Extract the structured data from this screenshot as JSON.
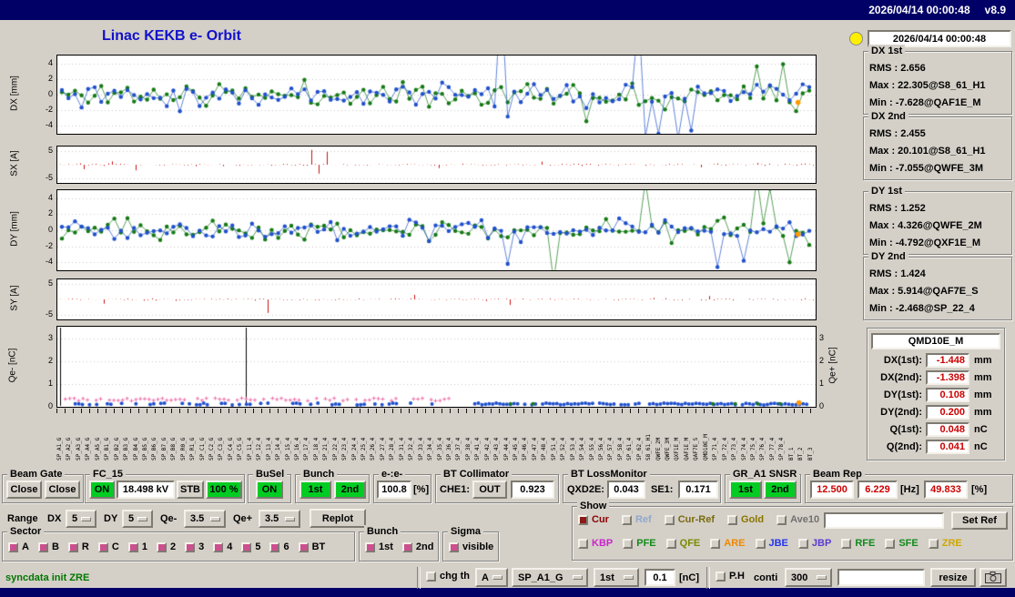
{
  "titlebar": {
    "clock": "2026/04/14 00:00:48",
    "version": "v8.9"
  },
  "header": {
    "title": "Linac KEKB e- Orbit",
    "timestamp": "2026/04/14 00:00:48"
  },
  "stats": [
    {
      "title": "DX 1st",
      "lines": [
        "RMS : 2.656",
        "Max : 22.305@S8_61_H1",
        "Min : -7.628@QAF1E_M"
      ]
    },
    {
      "title": "DX 2nd",
      "lines": [
        "RMS : 2.455",
        "Max : 20.101@S8_61_H1",
        "Min : -7.055@QWFE_3M"
      ]
    },
    {
      "title": "DY 1st",
      "lines": [
        "RMS : 1.252",
        "Max : 4.326@QWFE_2M",
        "Min : -4.792@QXF1E_M"
      ]
    },
    {
      "title": "DY 2nd",
      "lines": [
        "RMS : 1.424",
        "Max : 5.914@QAF7E_S",
        "Min : -2.468@SP_22_4"
      ]
    }
  ],
  "qmd": {
    "title": "QMD10E_M",
    "rows": [
      {
        "label": "DX(1st):",
        "value": "-1.448",
        "unit": "mm"
      },
      {
        "label": "DX(2nd):",
        "value": "-1.398",
        "unit": "mm"
      },
      {
        "label": "DY(1st):",
        "value": "0.108",
        "unit": "mm"
      },
      {
        "label": "DY(2nd):",
        "value": "0.200",
        "unit": "mm"
      },
      {
        "label": "Q(1st):",
        "value": "0.048",
        "unit": "nC"
      },
      {
        "label": "Q(2nd):",
        "value": "0.041",
        "unit": "nC"
      }
    ]
  },
  "controls": {
    "beam_gate": {
      "title": "Beam Gate",
      "close1": "Close",
      "close2": "Close"
    },
    "fc15": {
      "title": "FC_15",
      "on": "ON",
      "kv": "18.498 kV",
      "stb": "STB",
      "pct": "100 %"
    },
    "busel": {
      "title": "BuSel",
      "on": "ON"
    },
    "bunch": {
      "title": "Bunch",
      "b1": "1st",
      "b2": "2nd"
    },
    "ee": {
      "title": "e-:e-",
      "value": "100.8",
      "unit": "[%]"
    },
    "bt_col": {
      "title": "BT Collimator",
      "label": "CHE1:",
      "btn": "OUT",
      "value": "0.923"
    },
    "bt_loss": {
      "title": "BT LossMonitor",
      "l1": "QXD2E:",
      "v1": "0.043",
      "l2": "SE1:",
      "v2": "0.171"
    },
    "gr_snsr": {
      "title": "GR_A1 SNSR",
      "b1": "1st",
      "b2": "2nd"
    },
    "beam_rep": {
      "title": "Beam Rep",
      "v1": "12.500",
      "v2": "6.229",
      "u1": "[Hz]",
      "v3": "49.833",
      "u2": "[%]"
    },
    "range": {
      "label": "Range",
      "dx": "DX",
      "dx_val": "5",
      "dy": "DY",
      "dy_val": "5",
      "qem": "Qe-",
      "qem_val": "3.5",
      "qep": "Qe+",
      "qep_val": "3.5",
      "replot": "Replot"
    },
    "show": {
      "title": "Show",
      "set_ref": "Set Ref",
      "input_value": "",
      "row1": [
        {
          "label": "Cur",
          "color": "#8b0000",
          "box": "#8b1a1a"
        },
        {
          "label": "Ref",
          "color": "#8fa8cc",
          "box": "#d4d0c8"
        },
        {
          "label": "Cur-Ref",
          "color": "#7a6a10",
          "box": "#d4d0c8"
        },
        {
          "label": "Gold",
          "color": "#8a7400",
          "box": "#d4d0c8"
        },
        {
          "label": "Ave10",
          "color": "#707070",
          "box": "#d4d0c8"
        }
      ],
      "row2": [
        {
          "label": "KBP",
          "color": "#cc22cc",
          "box": "#d4d0c8"
        },
        {
          "label": "PFE",
          "color": "#118a1a",
          "box": "#d4d0c8"
        },
        {
          "label": "QFE",
          "color": "#7a8a00",
          "box": "#d4d0c8"
        },
        {
          "label": "ARE",
          "color": "#ee8800",
          "box": "#d4d0c8"
        },
        {
          "label": "JBE",
          "color": "#2233ee",
          "box": "#d4d0c8"
        },
        {
          "label": "JBP",
          "color": "#5a3ad0",
          "box": "#d4d0c8"
        },
        {
          "label": "RFE",
          "color": "#118a1a",
          "box": "#d4d0c8"
        },
        {
          "label": "SFE",
          "color": "#118a1a",
          "box": "#d4d0c8"
        },
        {
          "label": "ZRE",
          "color": "#cfa800",
          "box": "#d4d0c8"
        }
      ]
    },
    "sector": {
      "title": "Sector",
      "items": [
        "A",
        "B",
        "R",
        "C",
        "1",
        "2",
        "3",
        "4",
        "5",
        "6",
        "BT"
      ],
      "box": "#cc4f8f"
    },
    "bunch2": {
      "title": "Bunch",
      "items": [
        "1st",
        "2nd"
      ],
      "box": "#cc4f8f"
    },
    "sigma": {
      "title": "Sigma",
      "items": [
        "visible"
      ],
      "box": "#cc4f8f"
    }
  },
  "statusbar": {
    "message": "syncdata init ZRE",
    "chg_th": "chg th",
    "sel_a": "A",
    "sel_sp": "SP_A1_G",
    "sel_bunch": "1st",
    "thr": "0.1",
    "thr_unit": "[nC]",
    "ph": "P.H",
    "conti": "conti",
    "num": "300",
    "blank": "",
    "resize": "resize"
  },
  "chart_data": [
    {
      "id": "dx",
      "type": "scatter",
      "ylabel": "DX [mm]",
      "ylim": [
        -5,
        5
      ],
      "yticks": [
        4,
        2,
        0,
        -2,
        -4
      ],
      "n": 115,
      "sigma": 1.25,
      "seed": 11,
      "series": [
        {
          "name": "2nd",
          "color": "#157a15"
        },
        {
          "name": "1st",
          "color": "#2050cc"
        }
      ],
      "spikes_green": [
        [
          0.7,
          -3.4
        ],
        [
          0.93,
          3.6
        ],
        [
          0.965,
          3.9
        ]
      ],
      "spikes_blue": [
        [
          0.588,
          13
        ],
        [
          0.596,
          -2.8
        ],
        [
          0.776,
          10
        ],
        [
          0.785,
          -5.4
        ],
        [
          0.8,
          -5.0
        ],
        [
          0.825,
          -5.6
        ],
        [
          0.84,
          -4.6
        ]
      ],
      "end_marker": {
        "x": 0.985,
        "y": -1.0,
        "color": "#ff9900"
      }
    },
    {
      "id": "sx",
      "type": "bar",
      "ylabel": "SX [A]",
      "ylim": [
        -6.5,
        6.5
      ],
      "yticks": [
        5,
        -5
      ],
      "n": 190,
      "sigma": 0.35,
      "seed": 31,
      "color": "#cc1111",
      "spikes": [
        [
          0.03,
          -1.6
        ],
        [
          0.07,
          1.2
        ],
        [
          0.1,
          -2.0
        ],
        [
          0.335,
          5.3
        ],
        [
          0.345,
          -3.2
        ],
        [
          0.355,
          4.6
        ],
        [
          0.5,
          -1.2
        ],
        [
          0.64,
          1.1
        ],
        [
          0.85,
          -0.9
        ]
      ]
    },
    {
      "id": "dy",
      "type": "scatter",
      "ylabel": "DY [mm]",
      "ylim": [
        -5,
        5
      ],
      "yticks": [
        4,
        2,
        0,
        -2,
        -4
      ],
      "n": 115,
      "sigma": 1.1,
      "seed": 23,
      "series": [
        {
          "name": "2nd",
          "color": "#157a15"
        },
        {
          "name": "1st",
          "color": "#2050cc"
        }
      ],
      "spikes_green": [
        [
          0.656,
          -6.4
        ],
        [
          0.78,
          6.2
        ],
        [
          0.929,
          6.6
        ],
        [
          0.946,
          5.2
        ],
        [
          0.97,
          -4.0
        ]
      ],
      "spikes_blue": [
        [
          0.6,
          -4.2
        ],
        [
          0.88,
          -4.6
        ],
        [
          0.915,
          -3.8
        ]
      ],
      "end_marker": {
        "x": 0.985,
        "y": -0.5,
        "color": "#ff9900"
      }
    },
    {
      "id": "sy",
      "type": "bar",
      "ylabel": "SY [A]",
      "ylim": [
        -6.5,
        6.5
      ],
      "yticks": [
        5,
        -5
      ],
      "n": 190,
      "sigma": 0.3,
      "seed": 37,
      "color": "#cc1111",
      "spikes": [
        [
          0.06,
          -1.4
        ],
        [
          0.275,
          -4.4
        ],
        [
          0.47,
          1.5
        ],
        [
          0.6,
          -1.8
        ],
        [
          0.86,
          1.1
        ]
      ]
    },
    {
      "id": "qe",
      "type": "scatter",
      "ylabel": "Qe- [nC]",
      "ylabel_right": "Qe+ [nC]",
      "ylim": [
        0,
        3.5
      ],
      "yticks": [
        3,
        2,
        1,
        0
      ],
      "seed": 41,
      "pink_color": "#ee6fa8",
      "blue_color": "#2050cc",
      "green_color": "#157a15",
      "black_line_x": 0.249,
      "end_marker": {
        "x": 0.985,
        "y": 0.18,
        "color": "#ff9900"
      }
    }
  ],
  "stations": [
    "SP_A1_G",
    "SP_A2_G",
    "SP_A3_G",
    "SP_A4_G",
    "SP_A5_G",
    "SP_B1_G",
    "SP_B2_G",
    "SP_B3_G",
    "SP_B4_G",
    "SP_B5_G",
    "SP_B6_G",
    "SP_B7_G",
    "SP_B8_G",
    "SP_R0_G",
    "SP_R1_G",
    "SP_C1_G",
    "SP_C2_G",
    "SP_C3_G",
    "SP_C4_G",
    "SP_C5_G",
    "SP_11_4",
    "SP_12_4",
    "SP_13_4",
    "SP_14_4",
    "SP_15_4",
    "SP_16_4",
    "SP_17_4",
    "SP_18_4",
    "SP_21_4",
    "SP_22_4",
    "SP_23_4",
    "SP_24_4",
    "SP_25_4",
    "SP_26_4",
    "SP_27_4",
    "SP_28_4",
    "SP_31_4",
    "SP_32_4",
    "SP_33_4",
    "SP_34_4",
    "SP_35_4",
    "SP_36_4",
    "SP_37_4",
    "SP_38_4",
    "SP_41_4",
    "SP_42_4",
    "SP_43_4",
    "SP_44_4",
    "SP_45_4",
    "SP_46_4",
    "SP_47_4",
    "SP_48_4",
    "SP_51_4",
    "SP_52_4",
    "SP_53_4",
    "SP_54_4",
    "SP_55_4",
    "SP_56_4",
    "SP_57_4",
    "SP_58_4",
    "SP_61_4",
    "SP_62_4",
    "S8_61_H1",
    "QWFE_2M",
    "QWFE_3M",
    "QXF1E_M",
    "QAF1E_M",
    "QAF7E_S",
    "QMD10E_M",
    "SP_71_4",
    "SP_72_4",
    "SP_73_4",
    "SP_74_4",
    "SP_75_4",
    "SP_76_4",
    "SP_77_4",
    "SP_78_4",
    "BT_1",
    "BT_2",
    "BT_3"
  ]
}
